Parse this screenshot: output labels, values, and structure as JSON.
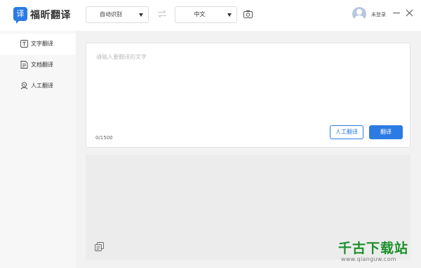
{
  "app": {
    "logo_char": "译",
    "name": "福昕翻译"
  },
  "header": {
    "source_language": "自动识别",
    "target_language": "中文",
    "user_status": "未登录"
  },
  "sidebar": {
    "items": [
      {
        "label": "文字翻译",
        "icon": "text-translate-icon",
        "active": true
      },
      {
        "label": "文档翻译",
        "icon": "document-translate-icon",
        "active": false
      },
      {
        "label": "人工翻译",
        "icon": "human-translate-icon",
        "active": false
      }
    ]
  },
  "input": {
    "placeholder": "请输入要翻译的文字",
    "value": "",
    "char_count": "0/1500"
  },
  "buttons": {
    "human_translate": "人工翻译",
    "translate": "翻译"
  },
  "watermark": {
    "title": "千古下载站",
    "url": "www.qianguw.com"
  },
  "colors": {
    "accent": "#2c7be5",
    "watermark_green": "#1a8f2a"
  }
}
